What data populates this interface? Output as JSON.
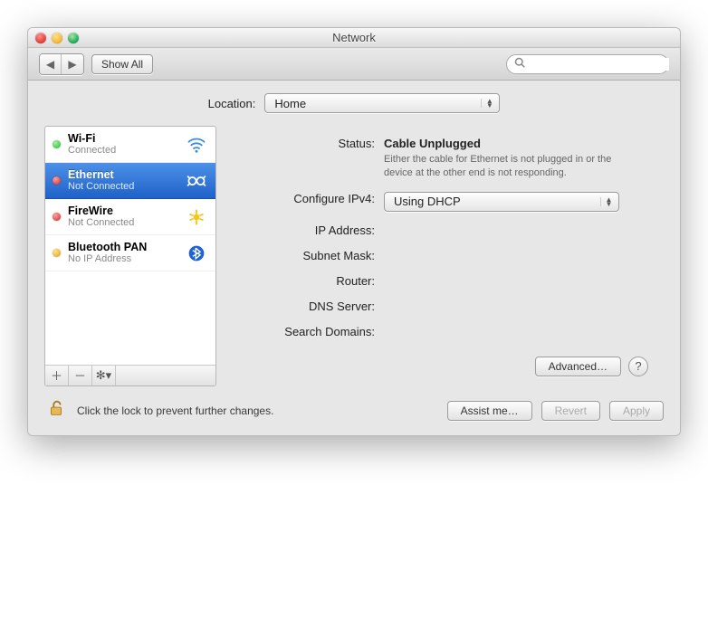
{
  "window": {
    "title": "Network"
  },
  "toolbar": {
    "show_all_label": "Show All",
    "search_placeholder": ""
  },
  "location": {
    "label": "Location:",
    "value": "Home"
  },
  "sources": [
    {
      "name": "Wi-Fi",
      "sub": "Connected",
      "status": "green",
      "icon": "wifi",
      "selected": false
    },
    {
      "name": "Ethernet",
      "sub": "Not Connected",
      "status": "red",
      "icon": "ethernet",
      "selected": true
    },
    {
      "name": "FireWire",
      "sub": "Not Connected",
      "status": "red",
      "icon": "firewire",
      "selected": false
    },
    {
      "name": "Bluetooth PAN",
      "sub": "No IP Address",
      "status": "amber",
      "icon": "bluetooth",
      "selected": false
    }
  ],
  "detail": {
    "labels": {
      "status": "Status:",
      "configure": "Configure IPv4:",
      "ip": "IP Address:",
      "subnet": "Subnet Mask:",
      "router": "Router:",
      "dns": "DNS Server:",
      "search": "Search Domains:"
    },
    "status_headline": "Cable Unplugged",
    "status_desc": "Either the cable for Ethernet is not plugged in or the device at the other end is not responding.",
    "configure_value": "Using DHCP",
    "ip": "",
    "subnet": "",
    "router": "",
    "dns": "",
    "search_domains": "",
    "advanced_label": "Advanced…"
  },
  "bottom": {
    "lock_message": "Click the lock to prevent further changes.",
    "assist_label": "Assist me…",
    "revert_label": "Revert",
    "apply_label": "Apply"
  }
}
